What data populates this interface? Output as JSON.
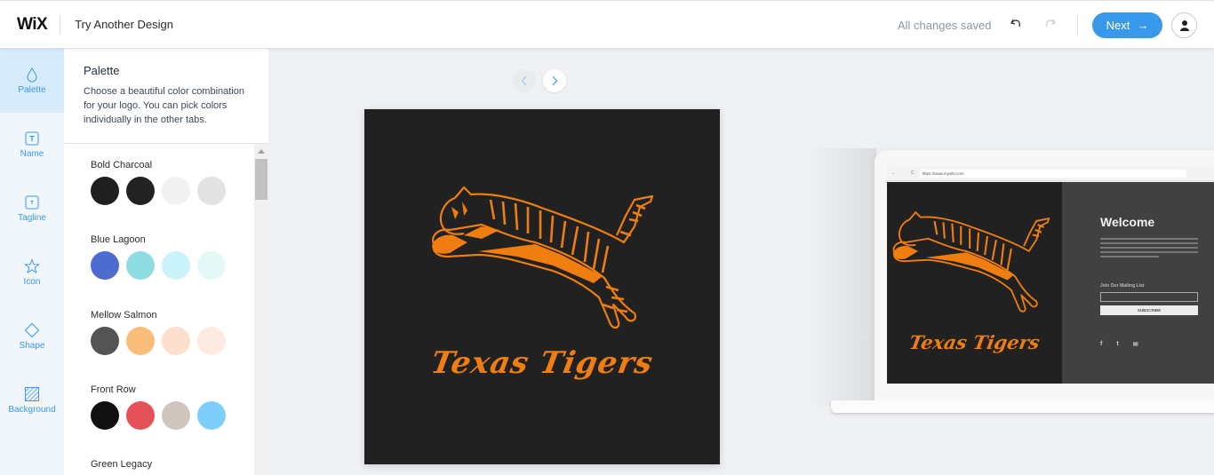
{
  "header": {
    "brand": "WiX",
    "title": "Try Another Design",
    "save_status": "All changes saved",
    "next_label": "Next",
    "next_arrow": "→",
    "accent_color": "#3899ec"
  },
  "sidebar": {
    "items": [
      {
        "label": "Palette",
        "icon": "drop-icon",
        "active": true
      },
      {
        "label": "Name",
        "icon": "text-box-icon"
      },
      {
        "label": "Tagline",
        "icon": "text-box-small-icon"
      },
      {
        "label": "Icon",
        "icon": "star-icon"
      },
      {
        "label": "Shape",
        "icon": "diamond-icon"
      },
      {
        "label": "Background",
        "icon": "hatched-square-icon"
      }
    ]
  },
  "panel": {
    "title": "Palette",
    "description": "Choose a beautiful color combination for your logo. You can pick colors individually in the other tabs.",
    "palettes": [
      {
        "name": "Bold Charcoal",
        "colors": [
          "#1f1f1f",
          "#222222",
          "#f1f1f1",
          "#e2e2e2"
        ]
      },
      {
        "name": "Blue Lagoon",
        "colors": [
          "#4e6bd0",
          "#8ddde2",
          "#cbf3fb",
          "#e4f8f8"
        ]
      },
      {
        "name": "Mellow Salmon",
        "colors": [
          "#545454",
          "#fbbd7a",
          "#fddfcd",
          "#fdebe3"
        ]
      },
      {
        "name": "Front Row",
        "colors": [
          "#111111",
          "#e6525a",
          "#cfc6c0",
          "#7dcffb"
        ]
      },
      {
        "name": "Green Legacy",
        "colors": []
      }
    ]
  },
  "canvas": {
    "logo_text": "Texas Tigers",
    "logo_bg": "#212121",
    "logo_color": "#f07d10"
  },
  "mockup": {
    "url": "https://www.mysite.com",
    "welcome": "Welcome",
    "mailing_label": "Join Our Mailing List",
    "subscribe_label": "SUBSCRIBE",
    "social_icons": [
      "facebook-icon",
      "twitter-icon",
      "mail-icon"
    ],
    "social_glyphs": [
      "f",
      "t",
      "✉"
    ]
  }
}
